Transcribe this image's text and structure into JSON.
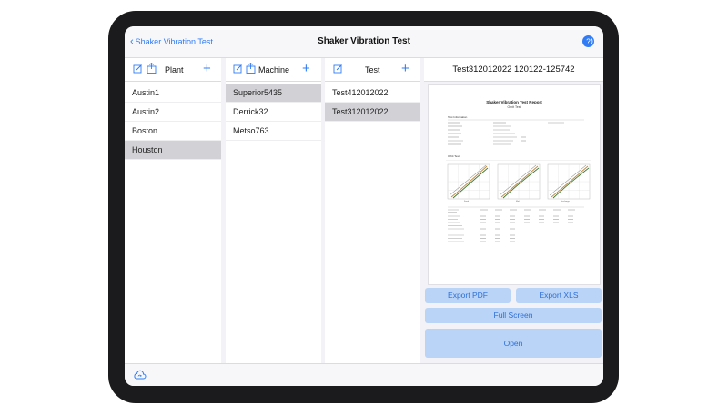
{
  "nav": {
    "back_label": "Shaker Vibration Test",
    "title": "Shaker Vibration Test"
  },
  "columns": {
    "plant": {
      "header": "Plant",
      "items": [
        "Austin1",
        "Austin2",
        "Boston",
        "Houston"
      ],
      "selected": "Houston"
    },
    "machine": {
      "header": "Machine",
      "items": [
        "Superior5435",
        "Derrick32",
        "Metso763"
      ],
      "selected": "Superior5435"
    },
    "test": {
      "header": "Test",
      "items": [
        "Test412012022",
        "Test312012022"
      ],
      "selected": "Test312012022"
    }
  },
  "detail": {
    "header": "Test312012022 120122-125742",
    "report_title": "Shaker Vibration Test Report",
    "report_subtitle": "Orbit Test",
    "section_info": "Test Information",
    "section_orbit": "Orbit Test",
    "plot_labels": [
      "Feed",
      "Mid",
      "Discharge"
    ],
    "export_pdf_label": "Export PDF",
    "export_xls_label": "Export XLS",
    "full_screen_label": "Full Screen",
    "open_label": "Open"
  },
  "colors": {
    "accent": "#2f7cf6",
    "button_bg": "#b9d4f6",
    "selection": "#d1d1d6",
    "device_bezel": "#1b1b1d"
  },
  "icons": [
    "chevron-left-icon",
    "help-icon",
    "edit-icon",
    "share-icon",
    "plus-icon",
    "cloud-sync-icon"
  ]
}
